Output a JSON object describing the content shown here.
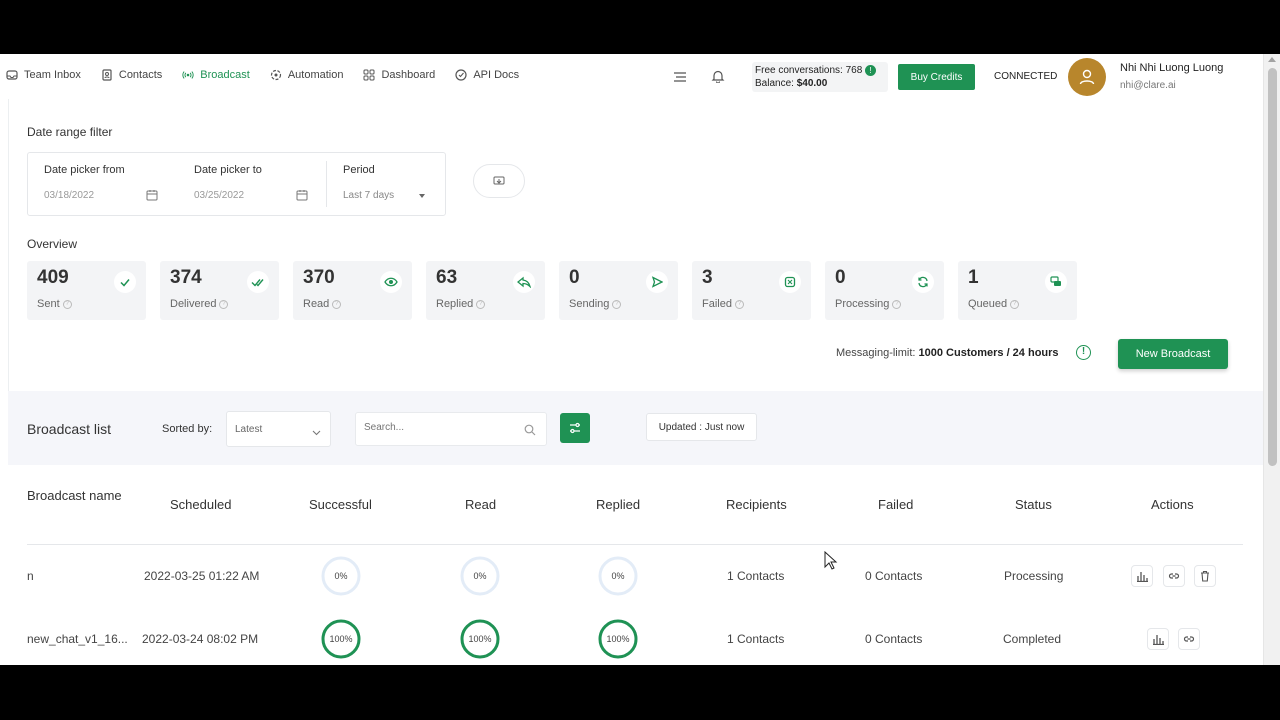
{
  "nav": {
    "items": [
      {
        "label": "Team Inbox",
        "icon": "inbox-icon",
        "active": false
      },
      {
        "label": "Contacts",
        "icon": "contacts-icon",
        "active": false
      },
      {
        "label": "Broadcast",
        "icon": "broadcast-icon",
        "active": true
      },
      {
        "label": "Automation",
        "icon": "automation-icon",
        "active": false
      },
      {
        "label": "Dashboard",
        "icon": "dashboard-icon",
        "active": false
      },
      {
        "label": "API Docs",
        "icon": "api-docs-icon",
        "active": false
      }
    ],
    "free_conversations": "Free conversations: 768",
    "balance_label": "Balance:",
    "balance_value": "$40.00",
    "buy_credits": "Buy Credits",
    "connection_status": "CONNECTED",
    "user": {
      "name": "Nhi Nhi Luong Luong",
      "email": "nhi@clare.ai"
    }
  },
  "date_filter": {
    "title": "Date range filter",
    "from_label": "Date picker from",
    "from_value": "03/18/2022",
    "to_label": "Date picker to",
    "to_value": "03/25/2022",
    "period_label": "Period",
    "period_value": "Last 7 days"
  },
  "overview": {
    "title": "Overview",
    "stats": [
      {
        "value": "409",
        "label": "Sent",
        "icon": "check-icon"
      },
      {
        "value": "374",
        "label": "Delivered",
        "icon": "double-check-icon"
      },
      {
        "value": "370",
        "label": "Read",
        "icon": "eye-icon"
      },
      {
        "value": "63",
        "label": "Replied",
        "icon": "reply-icon"
      },
      {
        "value": "0",
        "label": "Sending",
        "icon": "send-icon"
      },
      {
        "value": "3",
        "label": "Failed",
        "icon": "failed-icon"
      },
      {
        "value": "0",
        "label": "Processing",
        "icon": "refresh-icon"
      },
      {
        "value": "1",
        "label": "Queued",
        "icon": "queue-icon"
      }
    ],
    "limit_prefix": "Messaging-limit: ",
    "limit_value": "1000 Customers / 24 hours",
    "new_broadcast": "New Broadcast"
  },
  "broadcast_list": {
    "title": "Broadcast list",
    "sorted_by_label": "Sorted by:",
    "sorted_by_value": "Latest",
    "search_placeholder": "Search...",
    "updated": "Updated : Just now",
    "columns": [
      "Broadcast name",
      "Scheduled",
      "Successful",
      "Read",
      "Replied",
      "Recipients",
      "Failed",
      "Status",
      "Actions"
    ],
    "rows": [
      {
        "name": "n",
        "scheduled": "2022-03-25 01:22 AM",
        "successful": 0,
        "read": 0,
        "replied": 0,
        "successful_label": "0%",
        "read_label": "0%",
        "replied_label": "0%",
        "recipients": "1 Contacts",
        "failed": "0 Contacts",
        "status": "Processing"
      },
      {
        "name": "new_chat_v1_16...",
        "scheduled": "2022-03-24 08:02 PM",
        "successful": 100,
        "read": 100,
        "replied": 100,
        "successful_label": "100%",
        "read_label": "100%",
        "replied_label": "100%",
        "recipients": "1 Contacts",
        "failed": "0 Contacts",
        "status": "Completed"
      }
    ]
  },
  "colors": {
    "accent": "#1f9254",
    "ring_empty": "#e3ecf7",
    "card_bg": "#f3f4f6"
  }
}
